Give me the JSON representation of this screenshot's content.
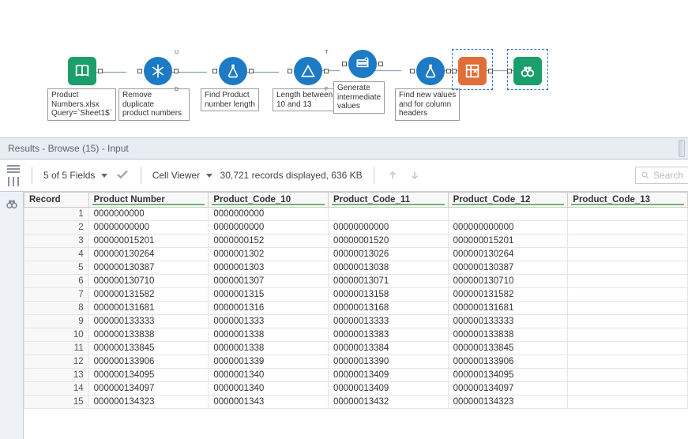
{
  "workflow": {
    "nodes": [
      {
        "id": "n1",
        "caption": "Product\nNumbers.xlsx\nQuery=`Sheet1$`"
      },
      {
        "id": "n2",
        "caption": "Remove duplicate\nproduct numbers"
      },
      {
        "id": "n3",
        "caption": "Find Product\nnumber length"
      },
      {
        "id": "n4",
        "caption": "Length between\n10 and 13"
      },
      {
        "id": "n5",
        "caption": "Generate\nintermediate\nvalues"
      },
      {
        "id": "n6",
        "caption": "Find new values\nand for column\nheaders"
      },
      {
        "id": "n7",
        "caption": ""
      },
      {
        "id": "n8",
        "caption": ""
      }
    ]
  },
  "results_header": "Results - Browse (15) - Input",
  "toolbar": {
    "fields_label": "5 of 5 Fields",
    "cellviewer_label": "Cell Viewer",
    "records_label": "30,721 records displayed, 636 KB",
    "search_placeholder": "Search"
  },
  "grid": {
    "columns": [
      "Record",
      "Product Number",
      "Product_Code_10",
      "Product_Code_11",
      "Product_Code_12",
      "Product_Code_13"
    ],
    "rows": [
      [
        "1",
        "0000000000",
        "0000000000",
        "",
        "",
        ""
      ],
      [
        "2",
        "00000000000",
        "0000000000",
        "00000000000",
        "000000000000",
        ""
      ],
      [
        "3",
        "000000015201",
        "0000000152",
        "00000001520",
        "000000015201",
        ""
      ],
      [
        "4",
        "000000130264",
        "0000001302",
        "00000013026",
        "000000130264",
        ""
      ],
      [
        "5",
        "000000130387",
        "0000001303",
        "00000013038",
        "000000130387",
        ""
      ],
      [
        "6",
        "000000130710",
        "0000001307",
        "00000013071",
        "000000130710",
        ""
      ],
      [
        "7",
        "000000131582",
        "0000001315",
        "00000013158",
        "000000131582",
        ""
      ],
      [
        "8",
        "000000131681",
        "0000001316",
        "00000013168",
        "000000131681",
        ""
      ],
      [
        "9",
        "000000133333",
        "0000001333",
        "00000013333",
        "000000133333",
        ""
      ],
      [
        "10",
        "000000133838",
        "0000001338",
        "00000013383",
        "000000133838",
        ""
      ],
      [
        "11",
        "000000133845",
        "0000001338",
        "00000013384",
        "000000133845",
        ""
      ],
      [
        "12",
        "000000133906",
        "0000001339",
        "00000013390",
        "000000133906",
        ""
      ],
      [
        "13",
        "000000134095",
        "0000001340",
        "00000013409",
        "000000134095",
        ""
      ],
      [
        "14",
        "000000134097",
        "0000001340",
        "00000013409",
        "000000134097",
        ""
      ],
      [
        "15",
        "000000134323",
        "0000001343",
        "00000013432",
        "000000134323",
        ""
      ]
    ]
  }
}
